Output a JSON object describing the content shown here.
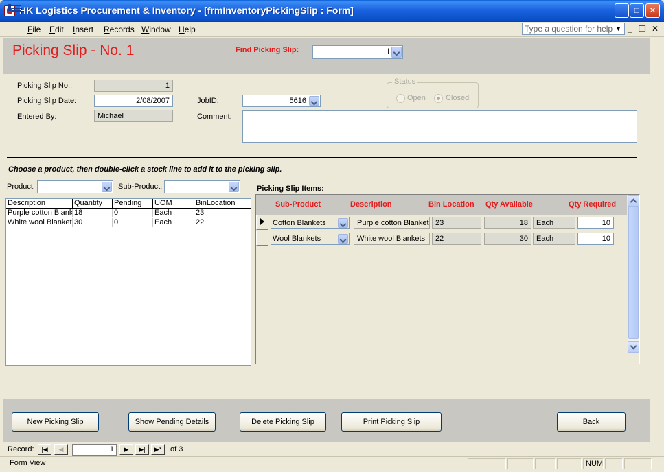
{
  "window": {
    "title": "HK Logistics Procurement & Inventory - [frmInventoryPickingSlip : Form]"
  },
  "menu": {
    "items": [
      "File",
      "Edit",
      "Insert",
      "Records",
      "Window",
      "Help"
    ]
  },
  "ask_box": {
    "placeholder": "Type a question for help"
  },
  "header": {
    "title": "Picking Slip - No. 1",
    "find_label": "Find Picking Slip:",
    "find_value": ""
  },
  "details": {
    "slip_no_label": "Picking Slip No.:",
    "slip_no": "1",
    "date_label": "Picking Slip Date:",
    "date": "2/08/2007",
    "entered_by_label": "Entered By:",
    "entered_by": "Michael",
    "jobid_label": "JobID:",
    "jobid": "5616",
    "comment_label": "Comment:",
    "comment": "",
    "status_label": "Status",
    "status_open": "Open",
    "status_closed": "Closed"
  },
  "instruction": "Choose a product, then double-click a stock line to add it to the picking slip.",
  "filters": {
    "product_label": "Product:",
    "product_value": "",
    "subproduct_label": "Sub-Product:",
    "subproduct_value": ""
  },
  "stock_list": {
    "headers": [
      "Description",
      "Quantity",
      "Pending",
      "UOM",
      "BinLocation"
    ],
    "rows": [
      [
        "Purple cotton Blank",
        "18",
        "0",
        "Each",
        "23"
      ],
      [
        "White wool Blanket",
        "30",
        "0",
        "Each",
        "22"
      ]
    ]
  },
  "items": {
    "label": "Picking Slip Items:",
    "headers": [
      "Sub-Product",
      "Description",
      "Bin Location",
      "Qty Available",
      "Qty Required"
    ],
    "rows": [
      {
        "subproduct": "Cotton Blankets",
        "description": "Purple cotton Blankets",
        "bin": "23",
        "available": "18",
        "uom": "Each",
        "required": "10"
      },
      {
        "subproduct": "Wool Blankets",
        "description": "White wool Blankets",
        "bin": "22",
        "available": "30",
        "uom": "Each",
        "required": "10"
      }
    ]
  },
  "buttons": {
    "new": "New Picking Slip",
    "pending": "Show Pending Details",
    "delete": "Delete Picking Slip",
    "print": "Print Picking Slip",
    "back": "Back"
  },
  "navigator": {
    "label": "Record:",
    "current": "1",
    "of_text": "of 3"
  },
  "statusbar": {
    "view": "Form View",
    "num": "NUM"
  }
}
